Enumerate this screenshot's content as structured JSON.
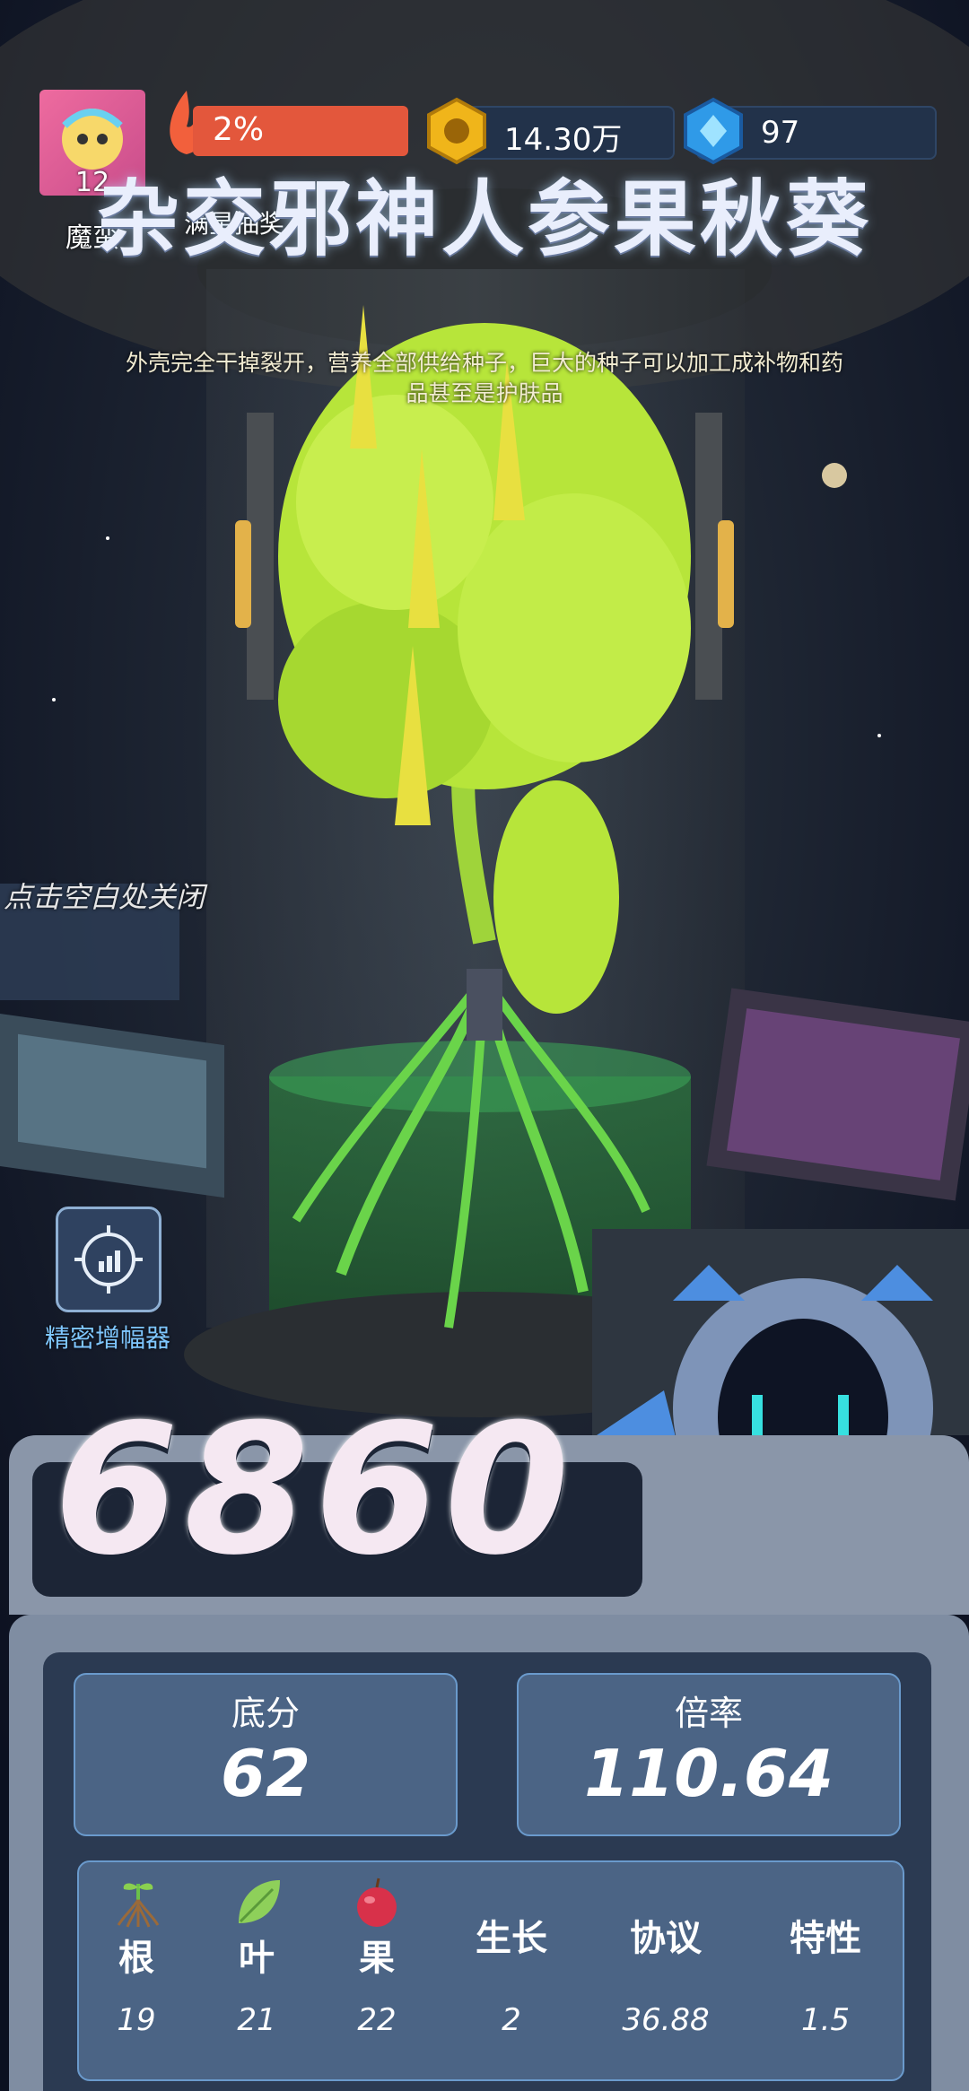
{
  "hud": {
    "player_level": "12",
    "player_name": "魔蛮",
    "energy_percent": "2%",
    "coins": "14.30万",
    "gems": "97",
    "star_reward_label": "满星抽奖"
  },
  "plant": {
    "title": "杂交邪神人参果秋葵",
    "description_line1": "外壳完全干掉裂开，营养全部供给种子，巨大的种子可以加工成补物和药",
    "description_line2": "品甚至是护肤品"
  },
  "hints": {
    "close_hint": "点击空白处关闭"
  },
  "amplifier": {
    "label": "精密增幅器"
  },
  "score": {
    "total": "6860",
    "base_label": "底分",
    "base_value": "62",
    "multiplier_label": "倍率",
    "multiplier_value": "110.64"
  },
  "attributes": [
    {
      "label": "根",
      "value": "19",
      "icon": "root-icon"
    },
    {
      "label": "叶",
      "value": "21",
      "icon": "leaf-icon"
    },
    {
      "label": "果",
      "value": "22",
      "icon": "fruit-icon"
    },
    {
      "label": "生长",
      "value": "2"
    },
    {
      "label": "协议",
      "value": "36.88"
    },
    {
      "label": "特性",
      "value": "1.5"
    }
  ],
  "colors": {
    "energy_bar": "#e3573c",
    "panel_bg": "#2b3a52",
    "card_bg": "#4b6485",
    "amplifier_text": "#7fc7ff",
    "plant_leaf": "#b7e53a"
  }
}
